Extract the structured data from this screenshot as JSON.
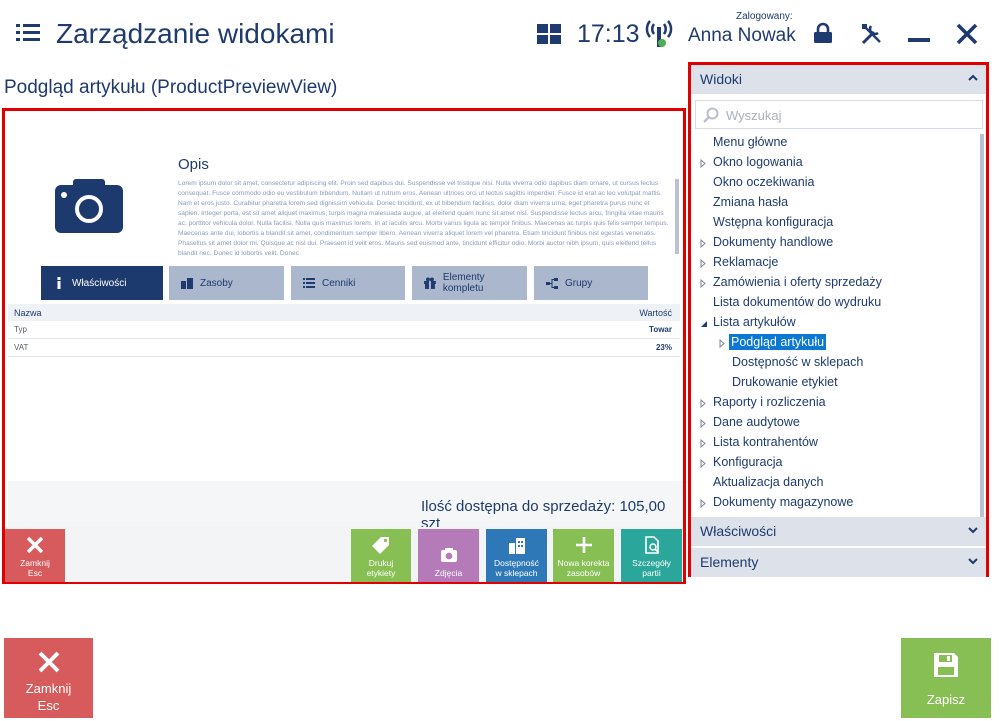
{
  "header": {
    "title": "Zarządzanie widokami",
    "time": "17:13",
    "logged_label": "Zalogowany:",
    "user": "Anna Nowak"
  },
  "view_title": "Podgląd artykułu (ProductPreviewView)",
  "preview": {
    "description_title": "Opis",
    "description_text": "Lorem ipsum dolor sit amet, consectetur adipiscing elit. Proin sed dapibus dui. Suspendisse vel tristique nisi. Nulla viverra odio dapibus diam ornare, ut cursus lectus consequat. Fusce commodo odio eu vestibulum bibendum. Nullam ut rutrum eros. Aenean ultrices orci ut lectus sagittis imperdiet. Fusce id erat ac leo volutpat mattis. Nam et eros justo. Curabitur pharetra lorem sed dignissim vehicula. Donec tincidunt, ex ut bibendum facilisis, dolor diam viverra urna, eget pharetra purus nunc et sapien. Integer porta, est sit amet aliquet maximus, turpis magna malesuada augue, at eleifend quam nunc sit amet nisl. Suspendisse lectus arcu, fringilla vitae mauris ac, porttitor vehicula dolor. Nulla facilisi. Nulla quis maximus lorem. In at iaculis arcu. Morbi varius ligula ac tempor finibus. Maecenas ac turpis quis felis semper tempus. Maecenas ante dui, lobortis a blandit sit amet, condimentum semper libero. Aenean viverra aliquet lorem vel pharetra. Etiam tincidunt finibus nisl egestas venenatis. Phasellus sit amet dolor mi. Quisque ac nisl dui. Praesent id velit eros. Mauris sed euismod ante, tincidunt efficitur odio. Morbi auctor nibh ipsum, quis eleifend tellus blandit nec. Donec id lobortis velit. Donec",
    "tabs": [
      {
        "label": "Właściwości"
      },
      {
        "label": "Zasoby"
      },
      {
        "label": "Cenniki"
      },
      {
        "label": "Elementy kompletu"
      },
      {
        "label": "Grupy"
      }
    ],
    "table": {
      "col_name": "Nazwa",
      "col_value": "Wartość",
      "rows": [
        {
          "name": "Typ",
          "value": "Towar"
        },
        {
          "name": "VAT",
          "value": "23%"
        }
      ]
    },
    "quantity_label": "Ilość dostępna do sprzedaży:  105,00 szt",
    "actions": {
      "close_line1": "Zamknij",
      "close_line2": "Esc",
      "print_line1": "Drukuj",
      "print_line2": "etykiety",
      "photos": "Zdjęcia",
      "avail_line1": "Dostępność",
      "avail_line2": "w sklepach",
      "corr_line1": "Nowa korekta",
      "corr_line2": "zasobów",
      "details_line1": "Szczegóły",
      "details_line2": "partii"
    }
  },
  "views_panel": {
    "header": "Widoki",
    "search_placeholder": "Wyszukaj",
    "items": [
      {
        "label": "Menu główne"
      },
      {
        "label": "Okno logowania"
      },
      {
        "label": "Okno oczekiwania"
      },
      {
        "label": "Zmiana hasła"
      },
      {
        "label": "Wstępna konfiguracja"
      },
      {
        "label": "Dokumenty handlowe"
      },
      {
        "label": "Reklamacje"
      },
      {
        "label": "Zamówienia i oferty sprzedaży"
      },
      {
        "label": "Lista dokumentów do wydruku"
      },
      {
        "label": "Lista artykułów"
      },
      {
        "label": "Podgląd artykułu"
      },
      {
        "label": "Dostępność w sklepach"
      },
      {
        "label": "Drukowanie etykiet"
      },
      {
        "label": "Raporty i rozliczenia"
      },
      {
        "label": "Dane audytowe"
      },
      {
        "label": "Lista kontrahentów"
      },
      {
        "label": "Konfiguracja"
      },
      {
        "label": "Aktualizacja danych"
      },
      {
        "label": "Dokumenty magazynowe"
      }
    ],
    "properties_header": "Właściwości",
    "elements_header": "Elementy"
  },
  "footer": {
    "close_line1": "Zamknij",
    "close_line2": "Esc",
    "save": "Zapisz"
  },
  "colors": {
    "primary": "#1f3a6e",
    "highlight_border": "#e00000",
    "close_red": "#d75a5c",
    "save_green": "#87bf55",
    "selected_blue": "#0a78d4"
  }
}
